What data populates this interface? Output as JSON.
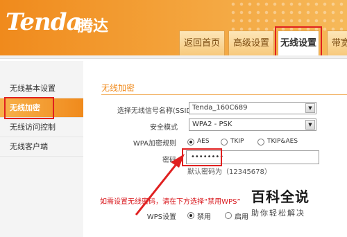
{
  "header": {
    "logo": "Tenda",
    "logo_cn": "腾达",
    "tabs": [
      {
        "label": "返回首页"
      },
      {
        "label": "高级设置"
      },
      {
        "label": "无线设置",
        "active": true
      },
      {
        "label": "带宽"
      }
    ]
  },
  "sidebar": {
    "items": [
      {
        "label": "无线基本设置"
      },
      {
        "label": "无线加密",
        "active": true
      },
      {
        "label": "无线访问控制"
      },
      {
        "label": "无线客户端"
      }
    ]
  },
  "main": {
    "section_title": "无线加密",
    "ssid_label": "选择无线信号名称(SSID)",
    "ssid_value": "Tenda_160C689",
    "security_label": "安全模式",
    "security_value": "WPA2 - PSK",
    "wpa_rule_label": "WPA加密规则",
    "wpa_rules": [
      "AES",
      "TKIP",
      "TKIP&AES"
    ],
    "wpa_rule_selected": "AES",
    "password_label": "密码",
    "password_value": "••••••••",
    "password_hint": "默认密码为（12345678）",
    "wps_warning": "如需设置无线密码，请在下方选择“禁用WPS”",
    "wps_label": "WPS设置",
    "wps_options": [
      "禁用",
      "启用"
    ],
    "wps_selected": "禁用"
  },
  "watermark": {
    "line1": "百科全说",
    "line2": "助你轻松解决"
  },
  "colors": {
    "accent": "#f08a1c",
    "highlight_box": "#e02020",
    "arrow": "#e02020",
    "warning_text": "#d8161b"
  }
}
